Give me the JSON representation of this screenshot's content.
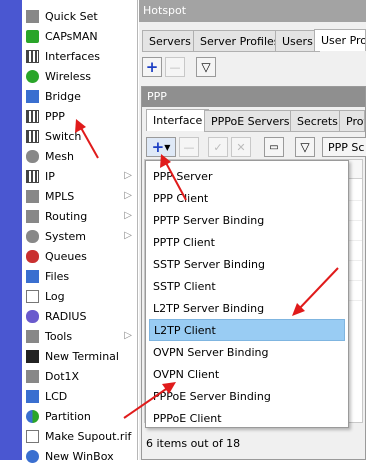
{
  "menu": {
    "items": [
      {
        "label": "Quick Set",
        "icon": "wand-icon"
      },
      {
        "label": "CAPsMAN",
        "icon": "wifi-icon"
      },
      {
        "label": "Interfaces",
        "icon": "interfaces-icon"
      },
      {
        "label": "Wireless",
        "icon": "wireless-icon"
      },
      {
        "label": "Bridge",
        "icon": "bridge-icon"
      },
      {
        "label": "PPP",
        "icon": "ppp-icon"
      },
      {
        "label": "Switch",
        "icon": "switch-icon"
      },
      {
        "label": "Mesh",
        "icon": "mesh-icon"
      },
      {
        "label": "IP",
        "icon": "ip-icon",
        "submenu": true
      },
      {
        "label": "MPLS",
        "icon": "mpls-icon",
        "submenu": true
      },
      {
        "label": "Routing",
        "icon": "routing-icon",
        "submenu": true
      },
      {
        "label": "System",
        "icon": "system-icon",
        "submenu": true
      },
      {
        "label": "Queues",
        "icon": "queues-icon"
      },
      {
        "label": "Files",
        "icon": "files-icon"
      },
      {
        "label": "Log",
        "icon": "log-icon"
      },
      {
        "label": "RADIUS",
        "icon": "radius-icon"
      },
      {
        "label": "Tools",
        "icon": "tools-icon",
        "submenu": true
      },
      {
        "label": "New Terminal",
        "icon": "terminal-icon"
      },
      {
        "label": "Dot1X",
        "icon": "dot1x-icon"
      },
      {
        "label": "LCD",
        "icon": "lcd-icon"
      },
      {
        "label": "Partition",
        "icon": "partition-icon"
      },
      {
        "label": "Make Supout.rif",
        "icon": "supout-icon"
      },
      {
        "label": "New WinBox",
        "icon": "winbox-icon"
      }
    ]
  },
  "hotspot": {
    "title": "Hotspot",
    "tabs": [
      "Servers",
      "Server Profiles",
      "Users",
      "User Profi"
    ]
  },
  "ppp": {
    "title": "PPP",
    "tabs": [
      "Interface",
      "PPPoE Servers",
      "Secrets",
      "Profi"
    ],
    "scanner_label": "PPP Sc",
    "status": "6 items out of 18"
  },
  "dropdown": {
    "items": [
      "PPP Server",
      "PPP Client",
      "PPTP Server Binding",
      "PPTP Client",
      "SSTP Server Binding",
      "SSTP Client",
      "L2TP Server Binding",
      "L2TP Client",
      "OVPN Server Binding",
      "OVPN Client",
      "PPPoE Server Binding",
      "PPPoE Client"
    ],
    "highlighted": "L2TP Client"
  },
  "colors": {
    "highlight": "#99ccf3",
    "arrow": "#e01b1b",
    "strip": "#4a57d1"
  }
}
